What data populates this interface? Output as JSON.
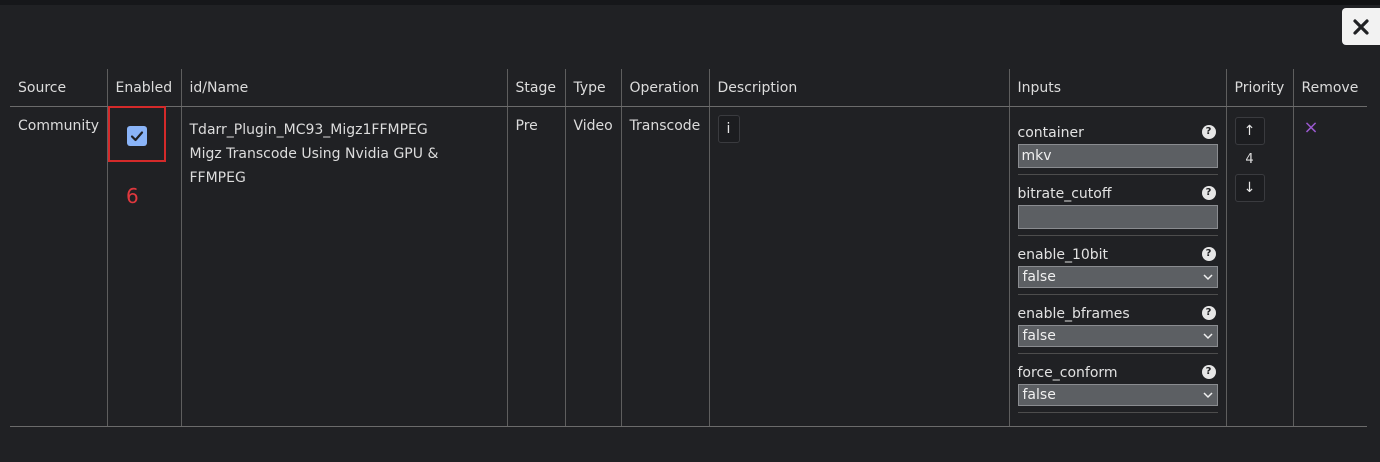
{
  "table": {
    "headers": [
      "Source",
      "Enabled",
      "id/Name",
      "Stage",
      "Type",
      "Operation",
      "Description",
      "Inputs",
      "Priority",
      "Remove"
    ],
    "row": {
      "source": "Community",
      "enabled": true,
      "plugin_id": "Tdarr_Plugin_MC93_Migz1FFMPEG",
      "plugin_name": "Migz Transcode Using Nvidia GPU & FFMPEG",
      "stage": "Pre",
      "type": "Video",
      "operation": "Transcode",
      "description_button": "i",
      "priority": "4",
      "remove_symbol": "×"
    },
    "inputs": {
      "container": {
        "label": "container",
        "value": "mkv"
      },
      "bitrate_cutoff": {
        "label": "bitrate_cutoff",
        "value": ""
      },
      "enable_10bit": {
        "label": "enable_10bit",
        "value": "false"
      },
      "enable_bframes": {
        "label": "enable_bframes",
        "value": "false"
      },
      "force_conform": {
        "label": "force_conform",
        "value": "false"
      },
      "help_symbol": "?"
    },
    "priority_up": "↑",
    "priority_down": "↓"
  },
  "annotation": {
    "label": "6",
    "color": "#d42a2a"
  },
  "icons": {
    "close": "close-icon",
    "checkbox": "check-icon",
    "help": "help-icon",
    "chevron": "chevron-down-icon"
  }
}
